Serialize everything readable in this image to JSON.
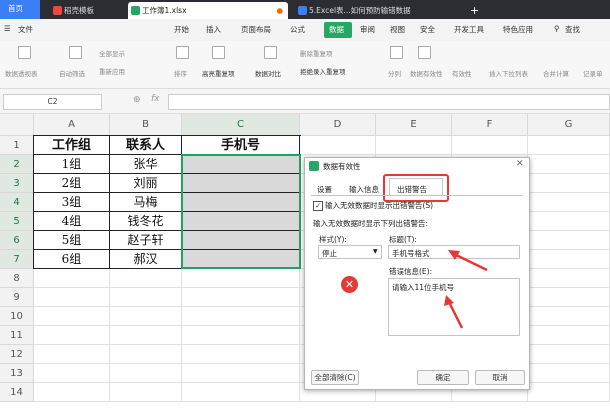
{
  "tabs": [
    {
      "label": "首页"
    },
    {
      "label": "稻壳模板"
    },
    {
      "label": "工作簿1.xlsx"
    },
    {
      "label": "5.Excel表...如何预防输错数据"
    }
  ],
  "menu": [
    "文件",
    "开始",
    "插入",
    "页面布局",
    "公式",
    "数据",
    "审阅",
    "视图",
    "安全",
    "开发工具",
    "特色应用",
    "查找"
  ],
  "ribbon": [
    "数据透视表",
    "自动筛选",
    "全部显示",
    "重新应用",
    "排序",
    "高亮重复项",
    "数据对比",
    "删除重复项",
    "拒绝录入重复项",
    "分列",
    "数据有效性",
    "有效性",
    "插入下拉列表",
    "合并计算",
    "记录单"
  ],
  "formula_bar": {
    "cell_ref": "C2",
    "fx": "fx"
  },
  "columns": [
    "A",
    "B",
    "C",
    "D",
    "E",
    "F",
    "G"
  ],
  "rows": [
    "1",
    "2",
    "3",
    "4",
    "5",
    "6",
    "7",
    "8",
    "9",
    "10",
    "11",
    "12",
    "13",
    "14"
  ],
  "table": {
    "headers": [
      "工作组",
      "联系人",
      "手机号"
    ],
    "data": [
      [
        "1组",
        "张华"
      ],
      [
        "2组",
        "刘丽"
      ],
      [
        "3组",
        "马梅"
      ],
      [
        "4组",
        "钱冬花"
      ],
      [
        "5组",
        "赵子轩"
      ],
      [
        "6组",
        "郝汉"
      ]
    ]
  },
  "dialog": {
    "title": "数据有效性",
    "tabs": [
      "设置",
      "输入信息",
      "出错警告"
    ],
    "checkbox_label": "输入无效数据时显示出错警告(S)",
    "section_label": "输入无效数据时显示下列出错警告:",
    "style_label": "样式(Y):",
    "style_value": "停止",
    "title_label": "标题(T):",
    "title_value": "手机号格式",
    "msg_label": "错误信息(E):",
    "msg_value": "请输入11位手机号",
    "clear_all": "全部清除(C)",
    "ok": "确定",
    "cancel": "取消"
  },
  "colors": {
    "accent": "#25a865",
    "highlight": "#e53935",
    "selection": "#21a366"
  }
}
